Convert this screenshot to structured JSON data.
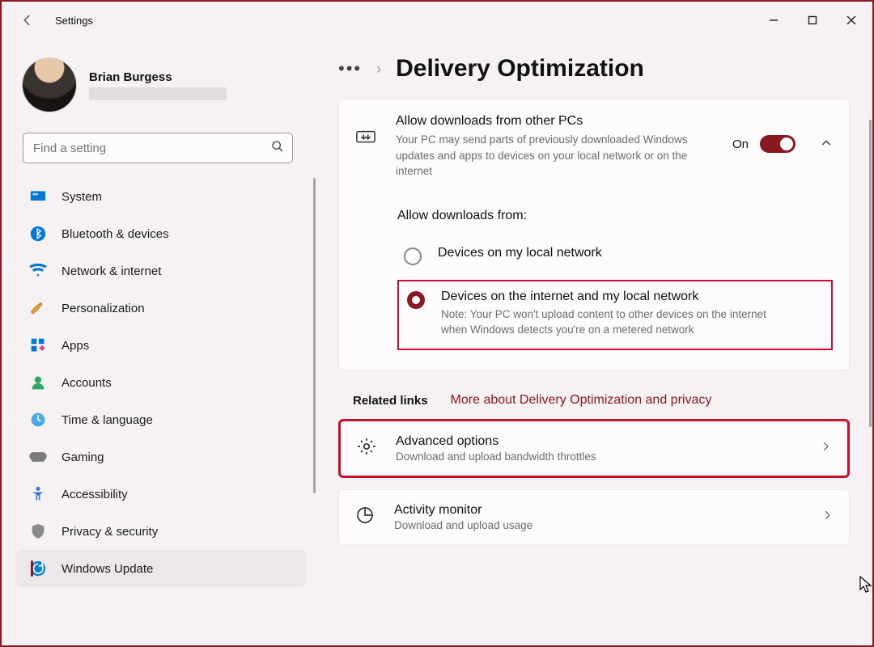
{
  "app": {
    "title": "Settings"
  },
  "profile": {
    "name": "Brian Burgess"
  },
  "search": {
    "placeholder": "Find a setting"
  },
  "sidebar": {
    "items": [
      {
        "label": "System"
      },
      {
        "label": "Bluetooth & devices"
      },
      {
        "label": "Network & internet"
      },
      {
        "label": "Personalization"
      },
      {
        "label": "Apps"
      },
      {
        "label": "Accounts"
      },
      {
        "label": "Time & language"
      },
      {
        "label": "Gaming"
      },
      {
        "label": "Accessibility"
      },
      {
        "label": "Privacy & security"
      },
      {
        "label": "Windows Update"
      }
    ]
  },
  "page": {
    "title": "Delivery Optimization"
  },
  "allow_card": {
    "title": "Allow downloads from other PCs",
    "desc": "Your PC may send parts of previously downloaded Windows updates and apps to devices on your local network or on the internet",
    "toggle_label": "On",
    "sub_title": "Allow downloads from:",
    "opt1": "Devices on my local network",
    "opt2": "Devices on the internet and my local network",
    "opt2_note": "Note: Your PC won't upload content to other devices on the internet when Windows detects you're on a metered network"
  },
  "related": {
    "label": "Related links",
    "link": "More about Delivery Optimization and privacy"
  },
  "rows": {
    "adv_title": "Advanced options",
    "adv_desc": "Download and upload bandwidth throttles",
    "act_title": "Activity monitor",
    "act_desc": "Download and upload usage"
  }
}
